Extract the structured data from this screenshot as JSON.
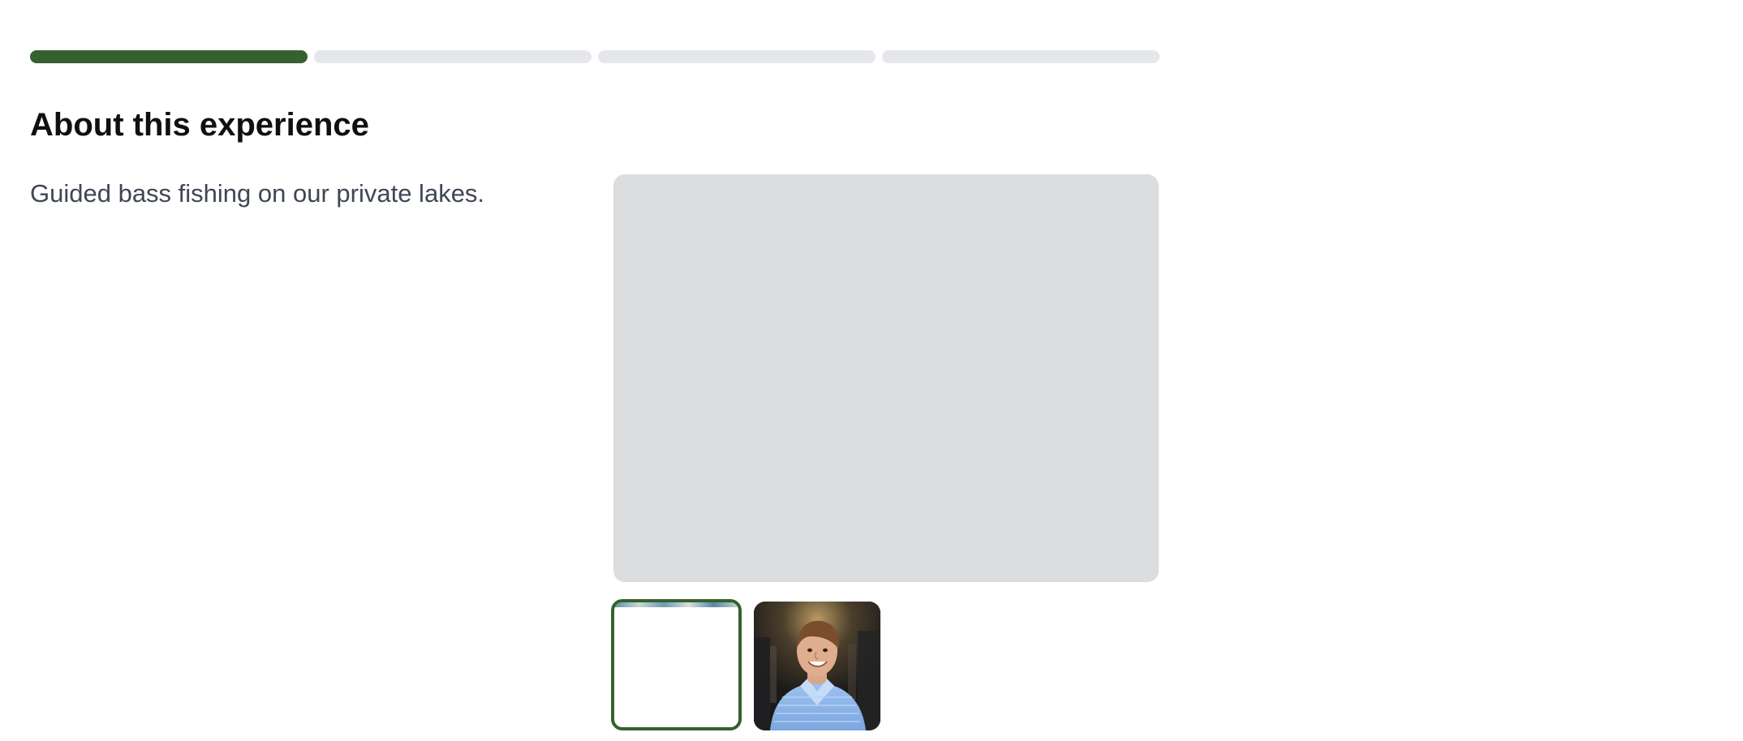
{
  "progress": {
    "total_steps": 4,
    "current_step": 1
  },
  "section": {
    "title": "About this experience",
    "description": "Guided bass fishing on our private lakes."
  },
  "gallery": {
    "selected_index": 0,
    "thumbnails": [
      {
        "name": "lake"
      },
      {
        "name": "guide portrait"
      }
    ]
  },
  "colors": {
    "accent": "#34612f",
    "inactive_progress": "#e5e7eb",
    "image_placeholder": "#dcdddf",
    "description_text": "#3f4654"
  }
}
